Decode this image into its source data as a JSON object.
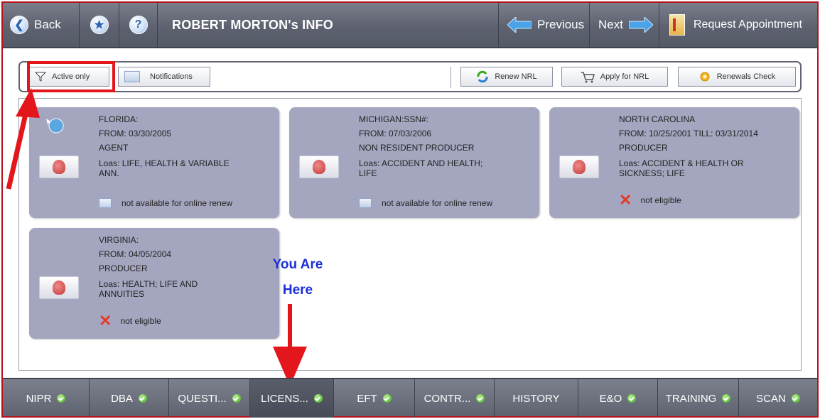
{
  "header": {
    "back_label": "Back",
    "title": "ROBERT MORTON's INFO",
    "previous_label": "Previous",
    "next_label": "Next",
    "request_label": "Request Appointment"
  },
  "toolbar": {
    "active_only": "Active only",
    "notifications": "Notifications",
    "renew_nrl": "Renew NRL",
    "apply_nrl": "Apply for NRL",
    "renewals_check": "Renewals Check"
  },
  "licenses": [
    {
      "state": "FLORIDA:",
      "from": "FROM: 03/30/2005",
      "type": "AGENT",
      "loas": "Loas: LIFE, HEALTH & VARIABLE",
      "loas2": "ANN.",
      "status": "not available for online renew"
    },
    {
      "state": "MICHIGAN:SSN#:",
      "from": "FROM: 07/03/2006",
      "type": "NON RESIDENT PRODUCER",
      "loas": "Loas: ACCIDENT AND HEALTH;",
      "loas2": "LIFE",
      "status": "not available for online renew"
    },
    {
      "state": "NORTH CAROLINA",
      "from": "FROM: 10/25/2001  TILL: 03/31/2014",
      "type": "PRODUCER",
      "loas": "Loas: ACCIDENT & HEALTH OR",
      "loas2": "SICKNESS; LIFE",
      "status": "not eligible"
    },
    {
      "state": "VIRGINIA:",
      "from": "FROM: 04/05/2004",
      "type": "PRODUCER",
      "loas": "Loas: HEALTH; LIFE AND",
      "loas2": "ANNUITIES",
      "status": "not eligible"
    }
  ],
  "annotation": {
    "line1": "You Are",
    "line2": "Here"
  },
  "tabs": [
    {
      "label": "NIPR",
      "active": false
    },
    {
      "label": "DBA",
      "active": false
    },
    {
      "label": "QUESTI...",
      "active": false
    },
    {
      "label": "LICENS...",
      "active": true
    },
    {
      "label": "EFT",
      "active": false
    },
    {
      "label": "CONTR...",
      "active": false
    },
    {
      "label": "HISTORY",
      "active": false
    },
    {
      "label": "E&O",
      "active": false
    },
    {
      "label": "TRAINING",
      "active": false
    },
    {
      "label": "SCAN",
      "active": false
    }
  ],
  "colors": {
    "highlight_red": "#e3161b",
    "annotation_blue": "#1b30d6",
    "card_bg": "#a4a6bf",
    "bar_bg": "#5e6270"
  }
}
